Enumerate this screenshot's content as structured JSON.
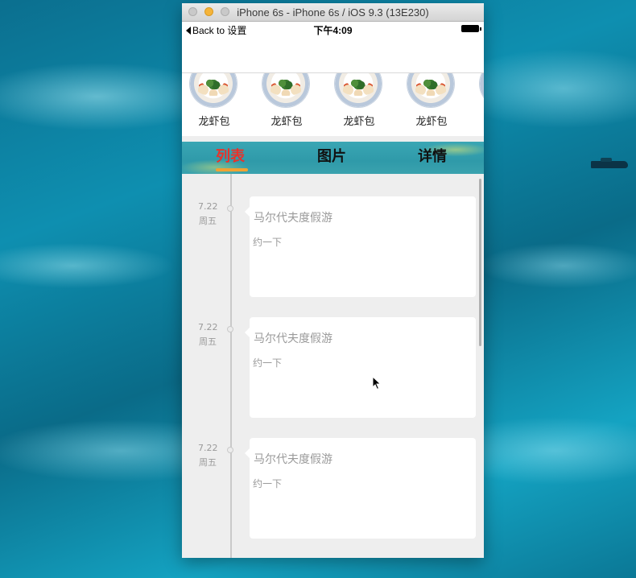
{
  "window": {
    "title": "iPhone 6s - iPhone 6s / iOS 9.3 (13E230)"
  },
  "status_bar": {
    "back_label": "Back to 设置",
    "time": "下午4:09"
  },
  "food_strip": {
    "items": [
      {
        "label": "龙虾包"
      },
      {
        "label": "龙虾包"
      },
      {
        "label": "龙虾包"
      },
      {
        "label": "龙虾包"
      }
    ]
  },
  "tabs": [
    {
      "label": "列表",
      "selected": true
    },
    {
      "label": "图片",
      "selected": false
    },
    {
      "label": "详情",
      "selected": false
    }
  ],
  "timeline": {
    "entries": [
      {
        "date": "7.22",
        "weekday": "周五",
        "title": "马尔代夫度假游",
        "subtitle": "约一下"
      },
      {
        "date": "7.22",
        "weekday": "周五",
        "title": "马尔代夫度假游",
        "subtitle": "约一下"
      },
      {
        "date": "7.22",
        "weekday": "周五",
        "title": "马尔代夫度假游",
        "subtitle": "约一下"
      }
    ]
  },
  "colors": {
    "tab_selected": "#e8332b",
    "tab_indicator": "#f0a233",
    "tab_bar_bg": "#2f9aa9",
    "content_bg": "#eeeeee"
  },
  "icons": [
    "back-arrow-icon",
    "battery-icon",
    "food-dish-icon",
    "mouse-cursor-icon"
  ]
}
